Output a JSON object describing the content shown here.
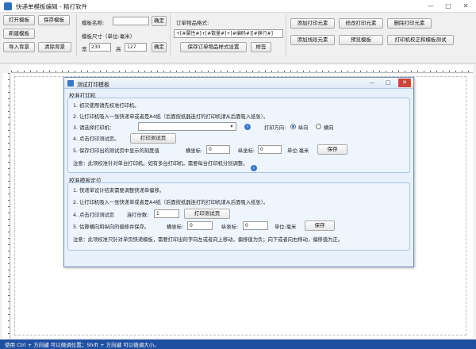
{
  "window": {
    "title": "快递单模板编辑 - 精打软件",
    "controls": [
      "—",
      "□",
      "✕"
    ]
  },
  "toolbar": {
    "open_template": "打开模板",
    "save_template": "保存模板",
    "new_template": "新建模板",
    "import_background": "导入背景",
    "clear_background": "清除背景",
    "template_name_label": "模板名称:",
    "template_name_value": "",
    "confirm_1": "确定",
    "template_size_label": "模板尺寸（单位:毫米）",
    "width_label": "宽",
    "width_value": "230",
    "height_label": "高",
    "height_value": "127",
    "confirm_2": "确定",
    "order_format_label": "订单物品格式:",
    "order_format_value": "+[#属性#]+[#数量#]+[#编码#][#换行#]",
    "save_order_format": "保存订单物品样式设置",
    "sample": "样签",
    "add_print_element": "添加打印元素",
    "modify_print_element": "修改打印元素",
    "delete_print_element": "删除打印元素",
    "add_line_element": "添加线段元素",
    "preview_template": "预览模板",
    "printer_calibration": "打印机校正和模板测试"
  },
  "status": {
    "text": "使用 Ctrl + 方向键 可以微调位置；Shift + 方向键 可以微调大小。"
  },
  "dialog": {
    "title": "测试打印模板",
    "group1": {
      "title": "校准打印机",
      "step1": "1. 初次使用请先校准打印机。",
      "step2": "2. 让打印机吸入一张快递单或者是A4纸（后面按纸器连打的打印机请从后面吸入纸张）。",
      "step3": "3. 请选择打印机：",
      "printer_value": "",
      "direction_label": "打印方向:",
      "portrait": "纵向",
      "landscape": "横向",
      "step4": "4. 点击打印测试页。",
      "print_test_button": "打印测试页",
      "step5": "5. 保存打印出的测试页中显示的刻度值",
      "x_label": "横坐标:",
      "x_value": "0",
      "y_label": "纵坐标:",
      "y_value": "0",
      "unit": "单位:毫米",
      "save_button": "保存",
      "note": "注意：此项校准针对单台打印机。如有多台打印机，需要每台打印机分别调整。",
      "info_icon": "i"
    },
    "group2": {
      "title": "校准模板定位",
      "step1": "1. 快递单设计结束需要调整快递单偏移。",
      "step2": "2. 让打印机吸入一张快递单或者是A4纸（后面按纸器连打的打印机请从后面吸入纸张）。",
      "step4": "4. 点击打印测试页",
      "copies_label": "连打份数:",
      "copies_value": "1",
      "print_test_button": "打印测试页",
      "step5": "5. 估算横向和纵向的偏移并保存。",
      "x_label": "横坐标:",
      "x_value": "0",
      "y_label": "纵坐标:",
      "y_value": "0",
      "unit": "单位:毫米",
      "save_button": "保存",
      "note": "注意：此项校准只针对单页快递模板，需要打印出的字向左或者向上移动，偏移值为负；向下或者向右移动，偏移值为正。"
    }
  },
  "colors": {
    "status_bar": "#1f4fa0",
    "dialog_bg": "#e8f1fb",
    "dialog_border": "#6e8fbf",
    "close_button": "#c9463d"
  }
}
